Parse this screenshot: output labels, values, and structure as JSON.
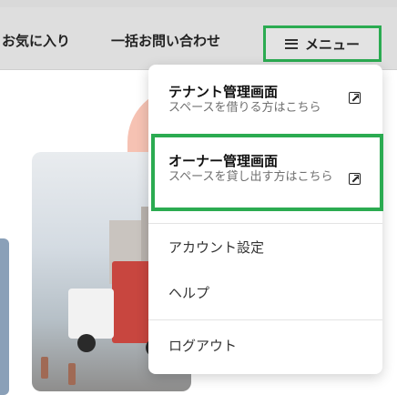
{
  "header": {
    "favorites_label": "お気に入り",
    "contact_label": "一括お問い合わせ",
    "menu_label": "メニュー"
  },
  "dropdown": {
    "tenant": {
      "title": "テナント管理画面",
      "subtitle": "スペースを借りる方はこちら"
    },
    "owner": {
      "title": "オーナー管理画面",
      "subtitle": "スペースを貸し出す方はこちら"
    },
    "account_settings": "アカウント設定",
    "help": "ヘルプ",
    "logout": "ログアウト"
  },
  "colors": {
    "highlight": "#2bab51",
    "header_bg": "#dedede",
    "accent_blob": "#f6c2b3"
  },
  "icons": [
    "hamburger-icon",
    "external-link-icon"
  ]
}
